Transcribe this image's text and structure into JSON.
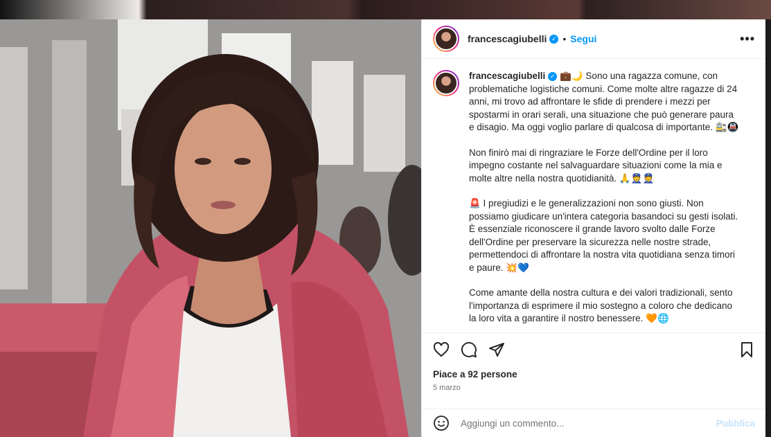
{
  "post": {
    "username": "francescagiubelli",
    "follow_label": "Segui",
    "separator": "•",
    "more_label": "•••",
    "caption_paragraphs": [
      "💼🌙 Sono una ragazza comune, con problematiche logistiche comuni. Come molte altre ragazze di 24 anni, mi trovo ad affrontare le sfide di prendere i mezzi per spostarmi in orari serali, una situazione che può generare paura e disagio. Ma oggi voglio parlare di qualcosa di importante. 🚉🚇",
      "Non finirò mai di ringraziare le Forze dell'Ordine per il loro impegno costante nel salvaguardare situazioni come la mia e molte altre nella nostra quotidianità. 🙏👮👮",
      "🚨 I pregiudizi e le generalizzazioni non sono giusti. Non possiamo giudicare un'intera categoria basandoci su gesti isolati. È essenziale riconoscere il grande lavoro svolto dalle Forze dell'Ordine per preservare la sicurezza nelle nostre strade, permettendoci di affrontare la nostra vita quotidiana senza timori e paure. 💥💙",
      "Come amante della nostra cultura e dei valori tradizionali, sento l'importanza di esprimere il mio sostegno a coloro che dedicano la loro vita a garantire il nostro benessere. 🧡🌐"
    ],
    "likes_text": "Piace a 92 persone",
    "date_text": "5 marzo"
  },
  "comment": {
    "placeholder": "Aggiungi un commento...",
    "publish_label": "Pubblica"
  },
  "icons": {
    "verified": "verified-badge-icon",
    "like": "heart-icon",
    "comment": "comment-icon",
    "share": "share-icon",
    "save": "bookmark-icon",
    "emoji": "emoji-icon"
  },
  "colors": {
    "accent": "#0095f6",
    "publish_disabled": "#c8e3fb"
  }
}
